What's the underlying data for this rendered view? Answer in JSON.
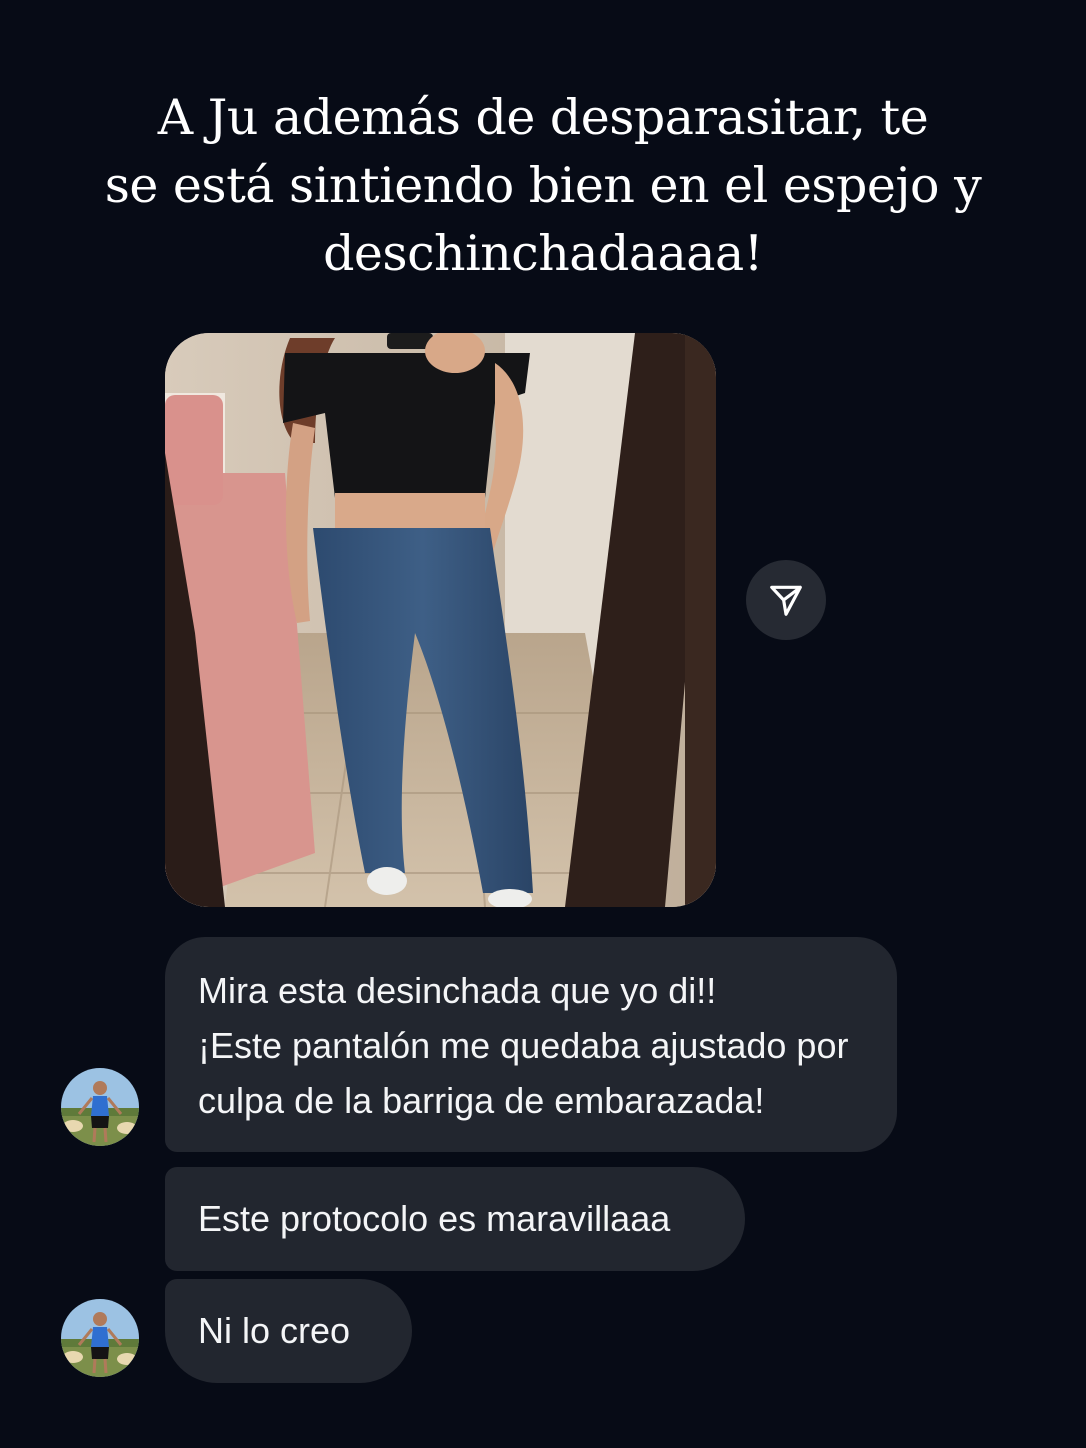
{
  "headline": {
    "line1": "A Ju además de desparasitar, te",
    "line2": "se está sintiendo bien en el espejo y",
    "line3": "deschinchadaaaa!"
  },
  "photo_message": {
    "image": "mirror-selfie-photo",
    "share_icon": "paper-plane-icon"
  },
  "messages": [
    {
      "lines": [
        "Mira esta desinchada que yo di!!",
        "¡Este pantalón me quedaba ajustado por",
        "culpa de la barriga de embarazada!"
      ]
    },
    {
      "lines": [
        "Este protocolo es maravillaaa"
      ]
    },
    {
      "lines": [
        "Ni lo creo"
      ]
    }
  ],
  "avatar_icon": "user-avatar-icon",
  "colors": {
    "background": "#070b16",
    "bubble": "#22262f",
    "share_button": "#262a33",
    "text": "#ffffff"
  }
}
